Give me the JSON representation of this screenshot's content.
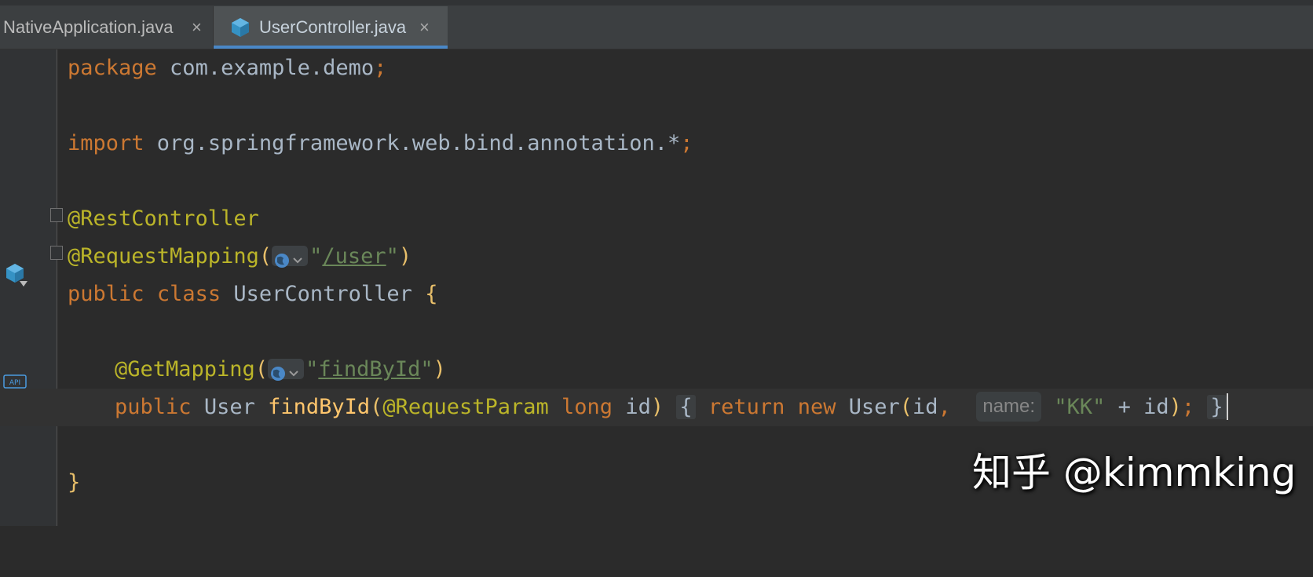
{
  "tabs": [
    {
      "label": "NativeApplication.java",
      "close": "×",
      "active": false
    },
    {
      "label": "UserController.java",
      "close": "×",
      "active": true
    }
  ],
  "code": {
    "line1": {
      "kw": "package",
      "rest": " com.example.demo",
      "semi": ";"
    },
    "line3": {
      "kw": "import",
      "rest": " org.springframework.web.bind.annotation.*",
      "semi": ";"
    },
    "line5": {
      "ann": "@RestController"
    },
    "line6": {
      "ann": "@RequestMapping",
      "open": "(",
      "q1": "\"",
      "path": "/user",
      "q2": "\"",
      "close": ")"
    },
    "line7": {
      "kw1": "public",
      "kw2": "class",
      "name": "UserController",
      "brace": "{"
    },
    "line9": {
      "ann": "@GetMapping",
      "open": "(",
      "q1": "\"",
      "path": "findById",
      "q2": "\"",
      "close": ")"
    },
    "line10": {
      "kw": "public",
      "type": "User",
      "method": "findById",
      "open": "(",
      "ann": "@RequestParam",
      "kw_long": "long",
      "param": "id",
      "close": ")",
      "brace_open": "{",
      "ret": "return",
      "new": "new",
      "ctor": "User",
      "args_open": "(",
      "arg1": "id",
      "comma": ",",
      "hint": "name:",
      "str": "\"KK\"",
      "plus": " + id",
      "args_close": ")",
      "semi": ";",
      "brace_close": "}"
    },
    "line12": {
      "brace": "}"
    }
  },
  "gutter": {
    "api_badge": "API"
  },
  "icons": [
    "java-class-icon",
    "globe-icon",
    "api-icon",
    "fold-icon"
  ],
  "colors": {
    "keyword": "#cc7832",
    "annotation": "#bbb529",
    "string": "#6a8759",
    "method": "#ffc66d",
    "text": "#a9b7c6",
    "background": "#2b2b2b"
  },
  "watermark": "知乎 @kimmking"
}
